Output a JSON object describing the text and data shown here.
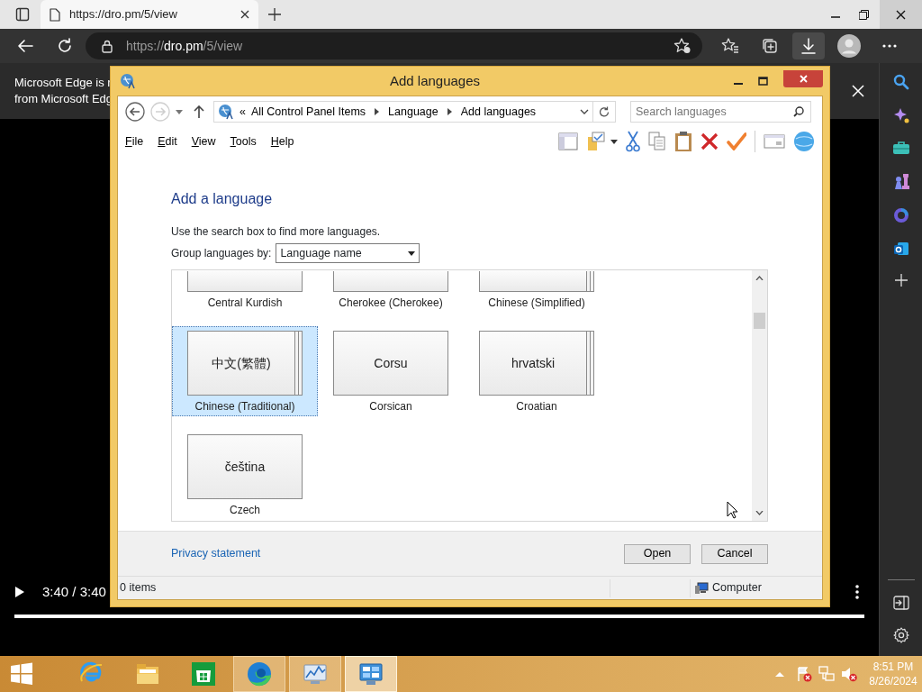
{
  "browser": {
    "tab": {
      "title": "https://dro.pm/5/view",
      "selected": true
    },
    "address": {
      "scheme": "https://",
      "host": "dro.pm",
      "path": "/5/view"
    },
    "downloads_active": true
  },
  "infobar": {
    "lines": [
      "Microsoft Edge is r",
      "from Microsoft Edg"
    ]
  },
  "player": {
    "time": "3:40 / 3:40",
    "level": 1
  },
  "dialog": {
    "title": "Add languages",
    "nav": {
      "back_disabled": false,
      "forward_disabled": true
    },
    "breadcrumb_overflow": "«",
    "breadcrumb": [
      "All Control Panel Items",
      "Language",
      "Add languages"
    ],
    "search_placeholder": "Search languages",
    "menu": [
      "File",
      "Edit",
      "View",
      "Tools",
      "Help"
    ],
    "heading": "Add a language",
    "hint": "Use the search box to find more languages.",
    "group_label": "Group languages by:",
    "group_value": "Language name",
    "languages": [
      {
        "name": "Central Kurdish",
        "partial": true,
        "stacked": false,
        "selected": false
      },
      {
        "name": "Cherokee (Cherokee)",
        "partial": true,
        "stacked": false,
        "selected": false
      },
      {
        "name": "Chinese (Simplified)",
        "partial": true,
        "stacked": true,
        "selected": false
      },
      {
        "name": "Chinese (Traditional)",
        "native": "中文(繁體)",
        "partial": false,
        "stacked": true,
        "selected": true
      },
      {
        "name": "Corsican",
        "native": "Corsu",
        "partial": false,
        "stacked": false,
        "selected": false
      },
      {
        "name": "Croatian",
        "native": "hrvatski",
        "partial": false,
        "stacked": true,
        "selected": false
      },
      {
        "name": "Czech",
        "native": "čeština",
        "partial": false,
        "stacked": false,
        "selected": false
      }
    ],
    "privacy": "Privacy statement",
    "buttons": [
      "Open",
      "Cancel"
    ],
    "status_left": "0 items",
    "status_right": "Computer"
  },
  "taskbar": {
    "apps": [
      {
        "kind": "ie",
        "running": false,
        "selected": false
      },
      {
        "kind": "explorer",
        "running": false,
        "selected": false
      },
      {
        "kind": "store",
        "running": false,
        "selected": false
      },
      {
        "kind": "edge",
        "running": true,
        "selected": false
      },
      {
        "kind": "perfmon",
        "running": true,
        "selected": false
      },
      {
        "kind": "controlpanel",
        "running": true,
        "selected": true
      }
    ],
    "time": "8:51 PM",
    "date": "8/26/2024"
  }
}
